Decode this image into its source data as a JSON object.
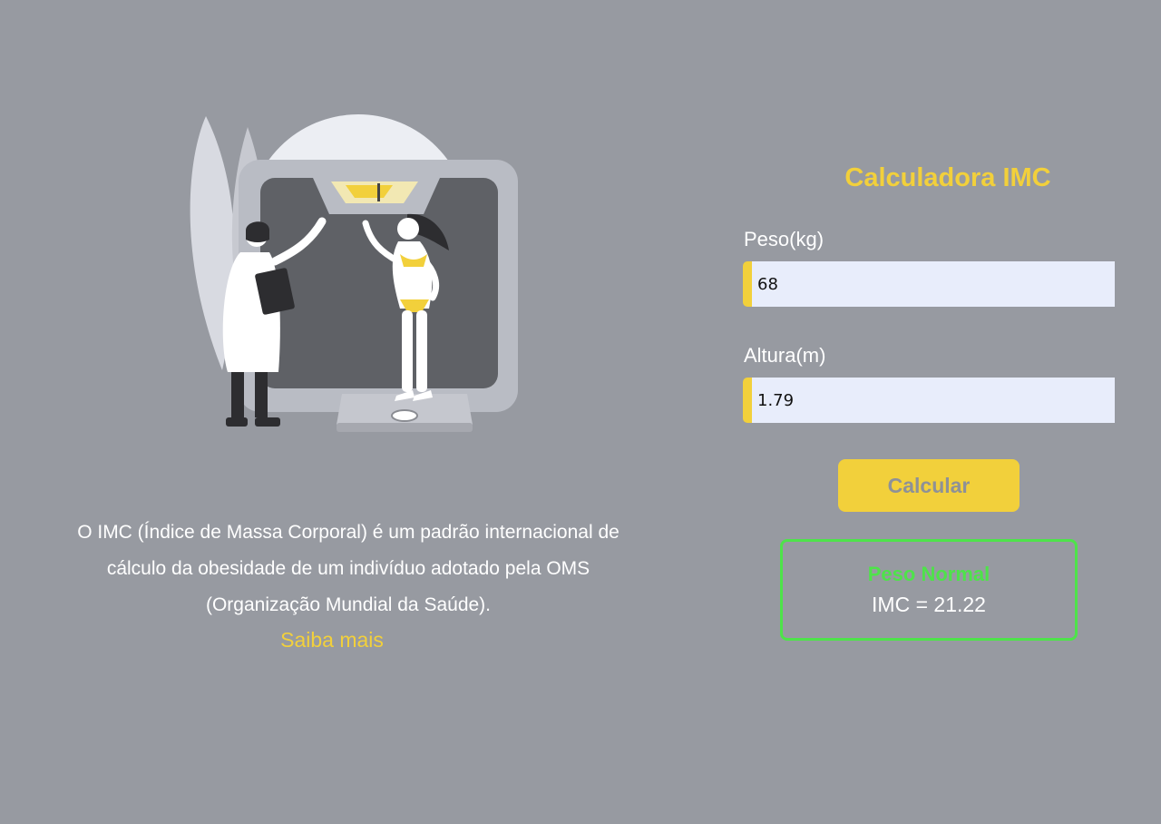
{
  "intro": {
    "description": "O IMC (Índice de Massa Corporal) é um padrão internacional de cálculo da obesidade de um indivíduo adotado pela OMS (Organização Mundial da Saúde).",
    "learn_more_label": "Saiba mais",
    "illustration_icon": "doctor-weighing-patient-illustration"
  },
  "calculator": {
    "title": "Calculadora IMC",
    "weight": {
      "label": "Peso(kg)",
      "value": "68"
    },
    "height": {
      "label": "Altura(m)",
      "value": "1.79"
    },
    "submit_label": "Calcular",
    "result": {
      "status": "Peso Normal",
      "value_text": "IMC = 21.22"
    }
  },
  "colors": {
    "background": "#979aa1",
    "accent": "#f2d03b",
    "success": "#4ee34a",
    "input_background": "#e8edfb"
  }
}
